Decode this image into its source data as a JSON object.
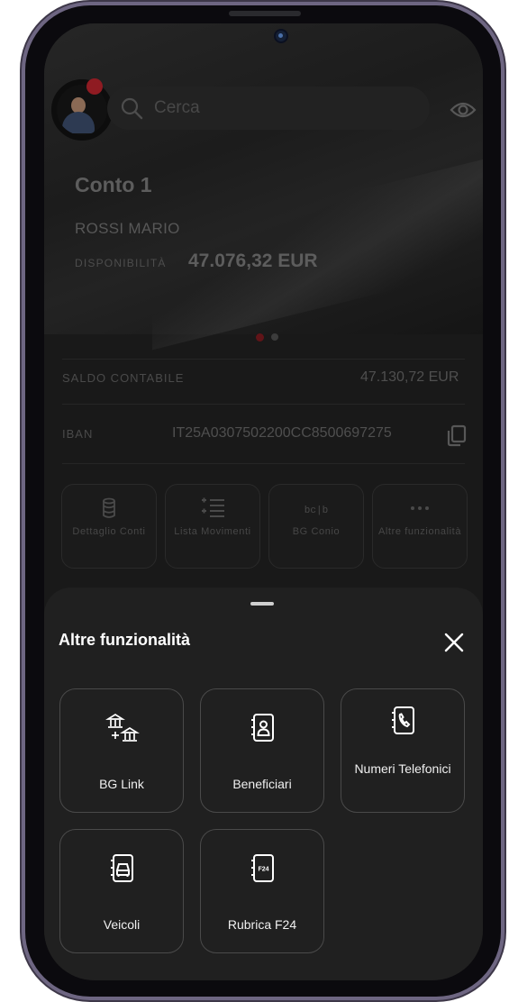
{
  "search": {
    "placeholder": "Cerca"
  },
  "account": {
    "title": "Conto 1",
    "holder": "ROSSI MARIO",
    "availability_label": "DISPONIBILITÀ",
    "availability_value": "47.076,32 EUR",
    "carousel_pages": 2,
    "carousel_active": 1
  },
  "details": {
    "balance_label": "SALDO CONTABILE",
    "balance_value": "47.130,72 EUR",
    "iban_label": "IBAN",
    "iban_value": "IT25A0307502200CC8500697275"
  },
  "quick_actions": [
    {
      "label": "Dettaglio Conti",
      "icon": "database-icon"
    },
    {
      "label": "Lista Movimenti",
      "icon": "list-icon"
    },
    {
      "label": "BG Conio",
      "icon": "bg-conio-icon"
    },
    {
      "label": "Altre funzionalità",
      "icon": "more-icon"
    }
  ],
  "sheet": {
    "title": "Altre funzionalità",
    "tiles": [
      {
        "label": "BG Link",
        "icon": "bank-transfer-icon"
      },
      {
        "label": "Beneficiari",
        "icon": "contact-book-icon"
      },
      {
        "label": "Numeri Telefonici",
        "icon": "phone-book-icon"
      },
      {
        "label": "Veicoli",
        "icon": "vehicle-book-icon"
      },
      {
        "label": "Rubrica F24",
        "icon": "f24-book-icon"
      }
    ]
  },
  "colors": {
    "accent": "#8f1b22",
    "sheet_bg": "#202020",
    "text": "#ffffff"
  }
}
